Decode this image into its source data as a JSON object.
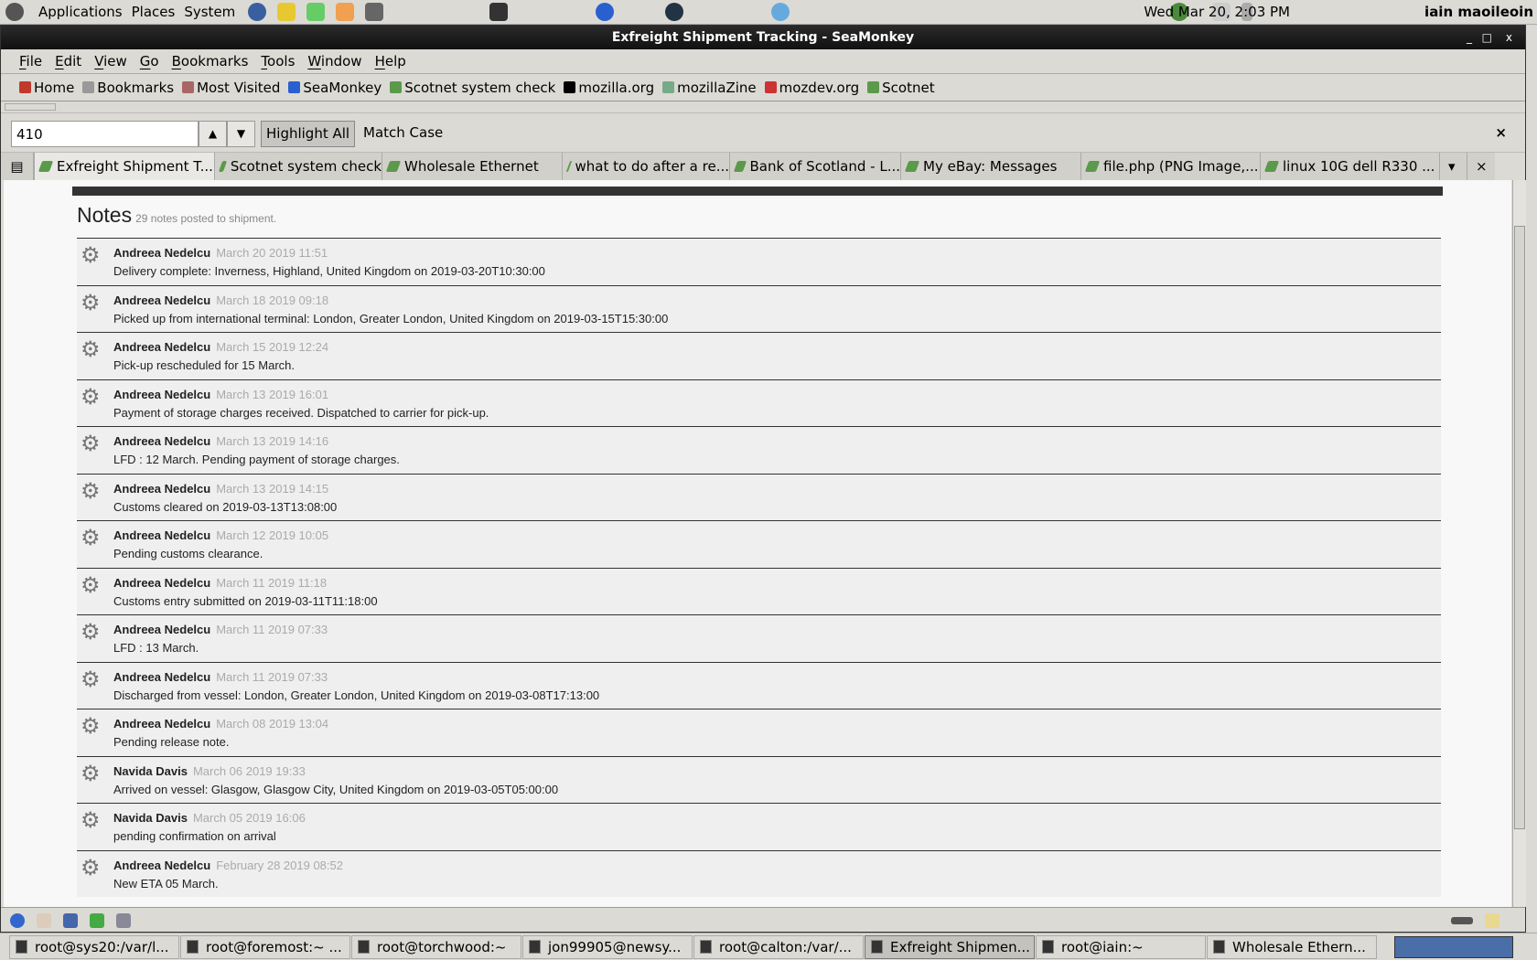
{
  "panel": {
    "menus": [
      "Applications",
      "Places",
      "System"
    ],
    "clock": "Wed Mar 20,  2:03 PM",
    "user": "iain maoileoin"
  },
  "window": {
    "title": "Exfreight Shipment Tracking - SeaMonkey",
    "controls": [
      "_",
      "□",
      "x"
    ]
  },
  "menubar": [
    "File",
    "Edit",
    "View",
    "Go",
    "Bookmarks",
    "Tools",
    "Window",
    "Help"
  ],
  "bookmarks": [
    {
      "label": "Home",
      "icon": "home-icon",
      "color": "#c0392b"
    },
    {
      "label": "Bookmarks",
      "icon": "folder-icon",
      "color": "#999"
    },
    {
      "label": "Most Visited",
      "icon": "folder-icon",
      "color": "#a66"
    },
    {
      "label": "SeaMonkey",
      "icon": "seamonkey-icon",
      "color": "#2a5fd0"
    },
    {
      "label": "Scotnet system check",
      "icon": "bookmark-icon",
      "color": "#5a9a4a"
    },
    {
      "label": "mozilla.org",
      "icon": "mozilla-icon",
      "color": "#000"
    },
    {
      "label": "mozillaZine",
      "icon": "zine-icon",
      "color": "#7a8"
    },
    {
      "label": "mozdev.org",
      "icon": "mozdev-icon",
      "color": "#c33"
    },
    {
      "label": "Scotnet",
      "icon": "bookmark-icon",
      "color": "#5a9a4a"
    }
  ],
  "findbar": {
    "value": "410",
    "highlight_all": "Highlight All",
    "match_case": "Match Case",
    "close": "×"
  },
  "tabs": [
    "Exfreight Shipment T...",
    "Scotnet system check",
    "Wholesale Ethernet",
    "what to do after a re...",
    "Bank of Scotland - L...",
    "My eBay: Messages",
    "file.php (PNG Image,...",
    "linux 10G dell R330 ..."
  ],
  "tabs_controls": {
    "list": "▾",
    "close": "×"
  },
  "page": {
    "heading": "Notes",
    "subheading": "29 notes posted to shipment.",
    "notes": [
      {
        "author": "Andreea Nedelcu",
        "date": "March 20 2019 11:51",
        "text": "Delivery complete: Inverness, Highland, United Kingdom on 2019-03-20T10:30:00"
      },
      {
        "author": "Andreea Nedelcu",
        "date": "March 18 2019 09:18",
        "text": "Picked up from international terminal: London, Greater London, United Kingdom on 2019-03-15T15:30:00"
      },
      {
        "author": "Andreea Nedelcu",
        "date": "March 15 2019 12:24",
        "text": "Pick-up rescheduled for 15 March."
      },
      {
        "author": "Andreea Nedelcu",
        "date": "March 13 2019 16:01",
        "text": "Payment of storage charges received. Dispatched to carrier for pick-up."
      },
      {
        "author": "Andreea Nedelcu",
        "date": "March 13 2019 14:16",
        "text": "LFD : 12 March. Pending payment of storage charges."
      },
      {
        "author": "Andreea Nedelcu",
        "date": "March 13 2019 14:15",
        "text": "Customs cleared on 2019-03-13T13:08:00"
      },
      {
        "author": "Andreea Nedelcu",
        "date": "March 12 2019 10:05",
        "text": "Pending customs clearance."
      },
      {
        "author": "Andreea Nedelcu",
        "date": "March 11 2019 11:18",
        "text": "Customs entry submitted on 2019-03-11T11:18:00"
      },
      {
        "author": "Andreea Nedelcu",
        "date": "March 11 2019 07:33",
        "text": "LFD : 13 March."
      },
      {
        "author": "Andreea Nedelcu",
        "date": "March 11 2019 07:33",
        "text": "Discharged from vessel: London, Greater London, United Kingdom on 2019-03-08T17:13:00"
      },
      {
        "author": "Andreea Nedelcu",
        "date": "March 08 2019 13:04",
        "text": "Pending release note."
      },
      {
        "author": "Navida Davis",
        "date": "March 06 2019 19:33",
        "text": "Arrived on vessel: Glasgow, Glasgow City, United Kingdom on 2019-03-05T05:00:00"
      },
      {
        "author": "Navida Davis",
        "date": "March 05 2019 16:06",
        "text": "pending confirmation on arrival"
      },
      {
        "author": "Andreea Nedelcu",
        "date": "February 28 2019 08:52",
        "text": "New ETA 05 March."
      }
    ]
  },
  "taskbar": [
    "root@sys20:/var/l...",
    "root@foremost:~ ...",
    "root@torchwood:~",
    "jon99905@newsy...",
    "root@calton:/var/...",
    "Exfreight Shipmen...",
    "root@iain:~",
    "Wholesale Ethern..."
  ],
  "taskbar_active": 5
}
